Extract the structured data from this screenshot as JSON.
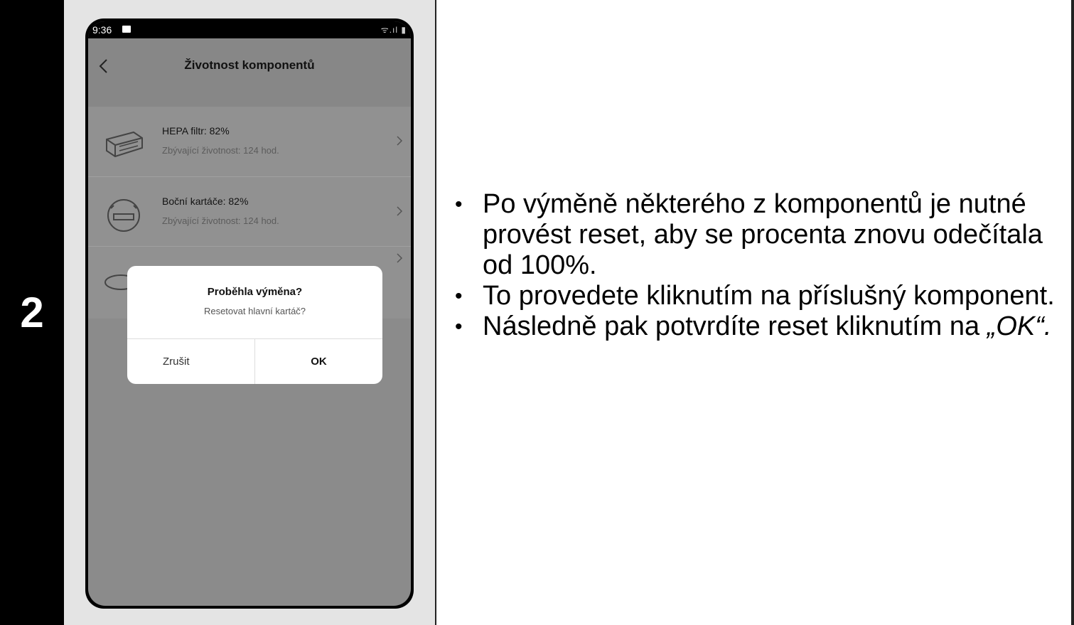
{
  "step": {
    "number": "2"
  },
  "phone": {
    "status": {
      "time": "9:36",
      "icons": "ᯤ.ıl ▮"
    },
    "appbar": {
      "title": "Životnost komponentů"
    },
    "components": [
      {
        "title": "HEPA filtr: 82%",
        "subtitle": "Zbývající životnost: 124 hod.",
        "icon": "hepa-filter-icon"
      },
      {
        "title": "Boční kartáče: 82%",
        "subtitle": "Zbývající životnost: 124 hod.",
        "icon": "side-brush-icon"
      },
      {
        "title": "",
        "subtitle": "",
        "icon": "main-brush-icon"
      }
    ],
    "dialog": {
      "title": "Proběhla výměna?",
      "message": "Resetovat hlavní kartáč?",
      "cancel": "Zrušit",
      "ok": "OK"
    }
  },
  "instructions": {
    "items": [
      "Po výměně některého z komponentů je nutné provést reset, aby se procenta znovu odečítala od 100%.",
      "To provedete kliknutím na příslušný komponent.",
      "Následně pak potvrdíte reset kliknutím na"
    ],
    "ok_ref": "„OK“.",
    "bullet": "•"
  },
  "colors": {
    "step_bg": "#000000",
    "panel_bg": "#e4e4e4",
    "dim_overlay": "#8b8b8b",
    "dialog_bg": "#ffffff"
  }
}
